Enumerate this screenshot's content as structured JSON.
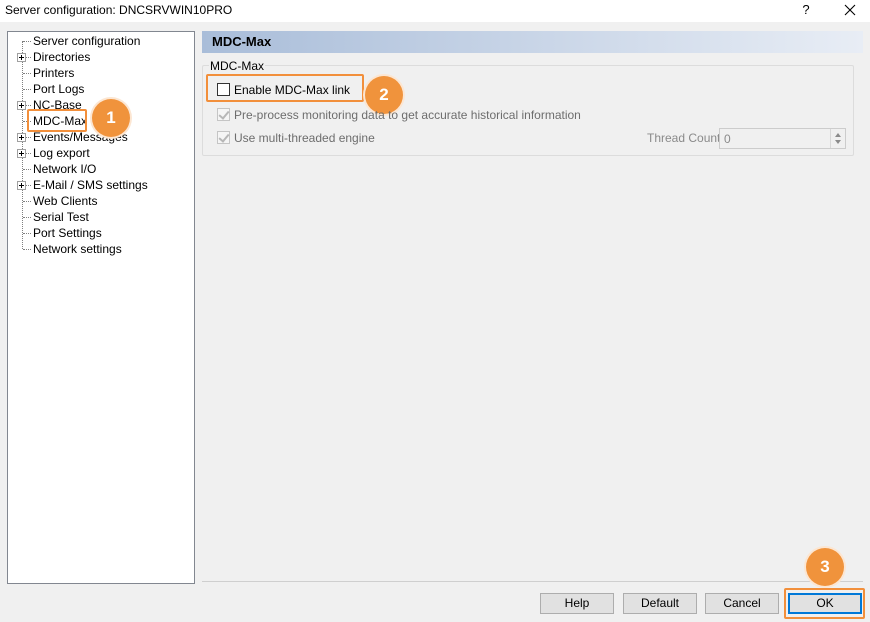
{
  "window": {
    "title": "Server configuration: DNCSRVWIN10PRO",
    "help_glyph": "?",
    "close_icon": "close-icon"
  },
  "tree": {
    "items": [
      {
        "label": "Server configuration",
        "expandable": false
      },
      {
        "label": "Directories",
        "expandable": true
      },
      {
        "label": "Printers",
        "expandable": false
      },
      {
        "label": "Port Logs",
        "expandable": false
      },
      {
        "label": "NC-Base",
        "expandable": true
      },
      {
        "label": "MDC-Max",
        "expandable": false,
        "selected": true
      },
      {
        "label": "Events/Messages",
        "expandable": true
      },
      {
        "label": "Log export",
        "expandable": true
      },
      {
        "label": "Network I/O",
        "expandable": false
      },
      {
        "label": "E-Mail / SMS settings",
        "expandable": true
      },
      {
        "label": "Web Clients",
        "expandable": false
      },
      {
        "label": "Serial Test",
        "expandable": false
      },
      {
        "label": "Port Settings",
        "expandable": false
      },
      {
        "label": "Network settings",
        "expandable": false
      }
    ]
  },
  "page": {
    "header": "MDC-Max",
    "group_title": "MDC-Max",
    "enable_link": {
      "label": "Enable MDC-Max link",
      "checked": false
    },
    "preprocess": {
      "label": "Pre-process monitoring data to get accurate historical information",
      "checked": true,
      "enabled": false
    },
    "multithread": {
      "label": "Use multi-threaded engine",
      "checked": true,
      "enabled": false
    },
    "thread_count": {
      "label": "Thread Count:",
      "value": "0",
      "enabled": false
    }
  },
  "callouts": {
    "one": "1",
    "two": "2",
    "three": "3",
    "color": "#f0933c"
  },
  "buttons": {
    "help": "Help",
    "default": "Default",
    "cancel": "Cancel",
    "ok": "OK"
  }
}
